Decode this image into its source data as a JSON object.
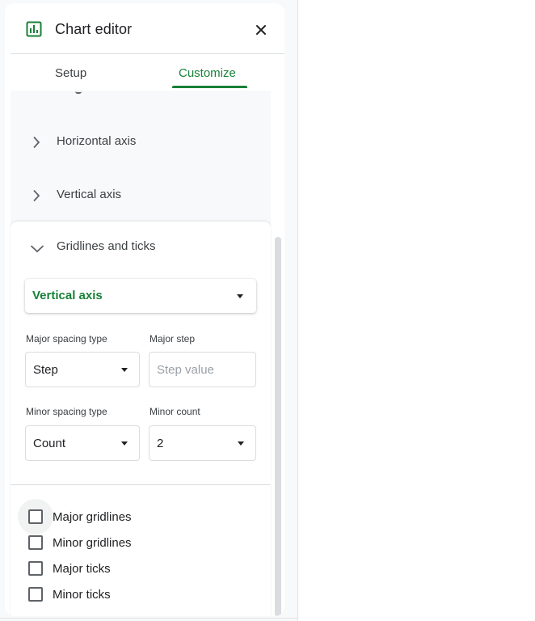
{
  "header": {
    "title": "Chart editor",
    "icon": "chart-icon",
    "close_icon": "close-icon"
  },
  "tabs": [
    {
      "label": "Setup",
      "active": false
    },
    {
      "label": "Customize",
      "active": true
    }
  ],
  "sections": {
    "horizontal_axis": {
      "label": "Horizontal axis",
      "expanded": false
    },
    "vertical_axis": {
      "label": "Vertical axis",
      "expanded": false
    },
    "gridlines": {
      "label": "Gridlines and ticks",
      "expanded": true,
      "axis_select": {
        "value": "Vertical axis"
      },
      "major_spacing_type": {
        "label": "Major spacing type",
        "value": "Step"
      },
      "major_step": {
        "label": "Major step",
        "placeholder": "Step value",
        "value": ""
      },
      "minor_spacing_type": {
        "label": "Minor spacing type",
        "value": "Count"
      },
      "minor_count": {
        "label": "Minor count",
        "value": "2"
      },
      "checkboxes": [
        {
          "label": "Major gridlines",
          "checked": false
        },
        {
          "label": "Minor gridlines",
          "checked": false
        },
        {
          "label": "Major ticks",
          "checked": false
        },
        {
          "label": "Minor ticks",
          "checked": false
        }
      ]
    }
  },
  "colors": {
    "accent": "#188038",
    "text": "#202124",
    "muted": "#3c4043",
    "divider": "#dadce0"
  }
}
